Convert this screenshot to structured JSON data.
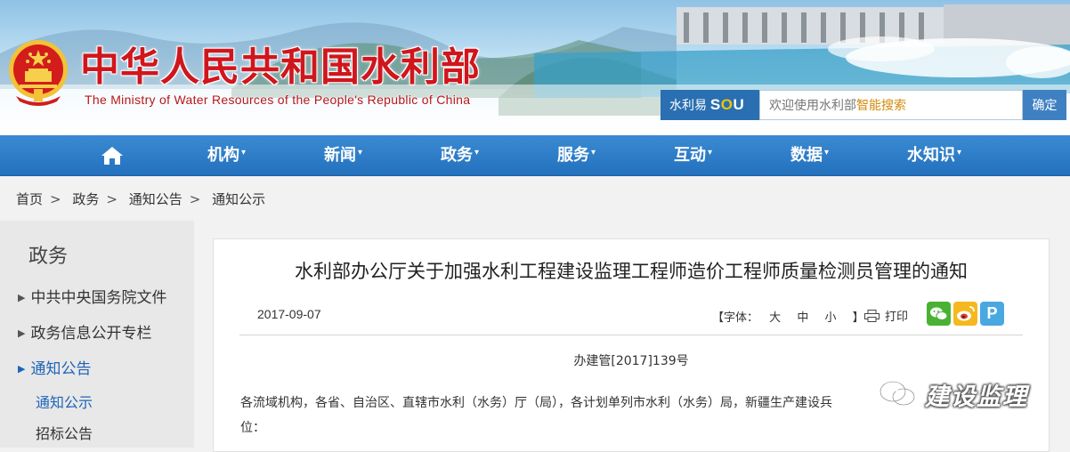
{
  "header": {
    "title": "中华人民共和国水利部",
    "subtitle": "The Ministry of Water Resources of the People's Republic of China"
  },
  "search": {
    "brand_prefix": "水利易",
    "brand_so": "S",
    "brand_o": "O",
    "brand_u": "U",
    "placeholder_prefix": "欢迎使用水利部",
    "placeholder_highlight": "智能搜索",
    "button_label": "确定"
  },
  "nav": {
    "items": [
      {
        "label": "机构"
      },
      {
        "label": "新闻"
      },
      {
        "label": "政务"
      },
      {
        "label": "服务"
      },
      {
        "label": "互动"
      },
      {
        "label": "数据"
      },
      {
        "label": "水知识"
      }
    ],
    "caret": "▾"
  },
  "breadcrumb": {
    "items": [
      "首页",
      "政务",
      "通知公告",
      "通知公示"
    ],
    "separator": ">"
  },
  "sidebar": {
    "title": "政务",
    "marker": "▶",
    "items": [
      {
        "label": "中共中央国务院文件"
      },
      {
        "label": "政务信息公开专栏"
      },
      {
        "label": "通知公告"
      }
    ],
    "subitems": [
      {
        "label": "通知公示"
      },
      {
        "label": "招标公告"
      }
    ]
  },
  "article": {
    "title": "水利部办公厅关于加强水利工程建设监理工程师造价工程师质量检测员管理的通知",
    "date": "2017-09-07",
    "font_label": "【字体：",
    "font_sizes": [
      "大",
      "中",
      "小"
    ],
    "font_close": "】",
    "print_label": "打印",
    "share_p": "P",
    "doc_number": "办建管[2017]139号",
    "body_line1": "各流域机构，各省、自治区、直辖市水利（水务）厅（局），各计划单列市水利（水务）局，新疆生产建设兵",
    "body_line2": "位："
  },
  "watermark": {
    "text": "建设监理"
  },
  "colors": {
    "title_red": "#d0161d",
    "nav_blue": "#2371bd",
    "link_blue": "#1e65b8",
    "search_brand_bg": "#2a6fb2"
  }
}
